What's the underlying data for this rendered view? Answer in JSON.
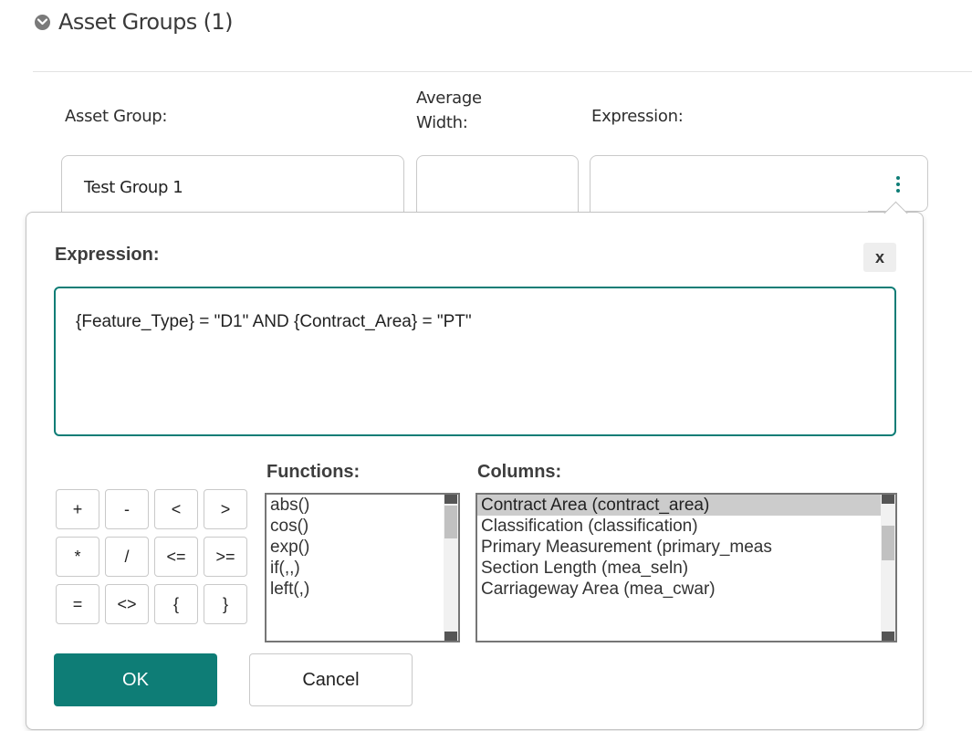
{
  "section": {
    "title": "Asset Groups (1)",
    "toggle_icon": "chevron-down-circle-icon"
  },
  "columns": {
    "asset_group": "Asset Group:",
    "average_width_line1": "Average",
    "average_width_line2": "Width:",
    "expression": "Expression:"
  },
  "row": {
    "asset_group_value": "Test Group 1",
    "average_width_value": "",
    "expression_value": ""
  },
  "popup": {
    "title": "Expression:",
    "close_label": "x",
    "expression_text": "{Feature_Type} = \"D1\" AND {Contract_Area} = \"PT\"",
    "operators": [
      "+",
      "-",
      "<",
      ">",
      "*",
      "/",
      "<=",
      ">=",
      "=",
      "<>",
      "{",
      "}"
    ],
    "functions_label": "Functions:",
    "functions": [
      "abs()",
      "cos()",
      "exp()",
      "if(,,)",
      "left(,)"
    ],
    "columns_label": "Columns:",
    "columns_list": [
      "Contract Area (contract_area)",
      "Classification (classification)",
      "Primary Measurement (primary_meas",
      "Section Length (mea_seln)",
      "Carriageway Area (mea_cwar)"
    ],
    "selected_column_index": 0,
    "ok_label": "OK",
    "cancel_label": "Cancel"
  },
  "colors": {
    "accent": "#0e7d76",
    "selected_row": "#cccccc"
  }
}
